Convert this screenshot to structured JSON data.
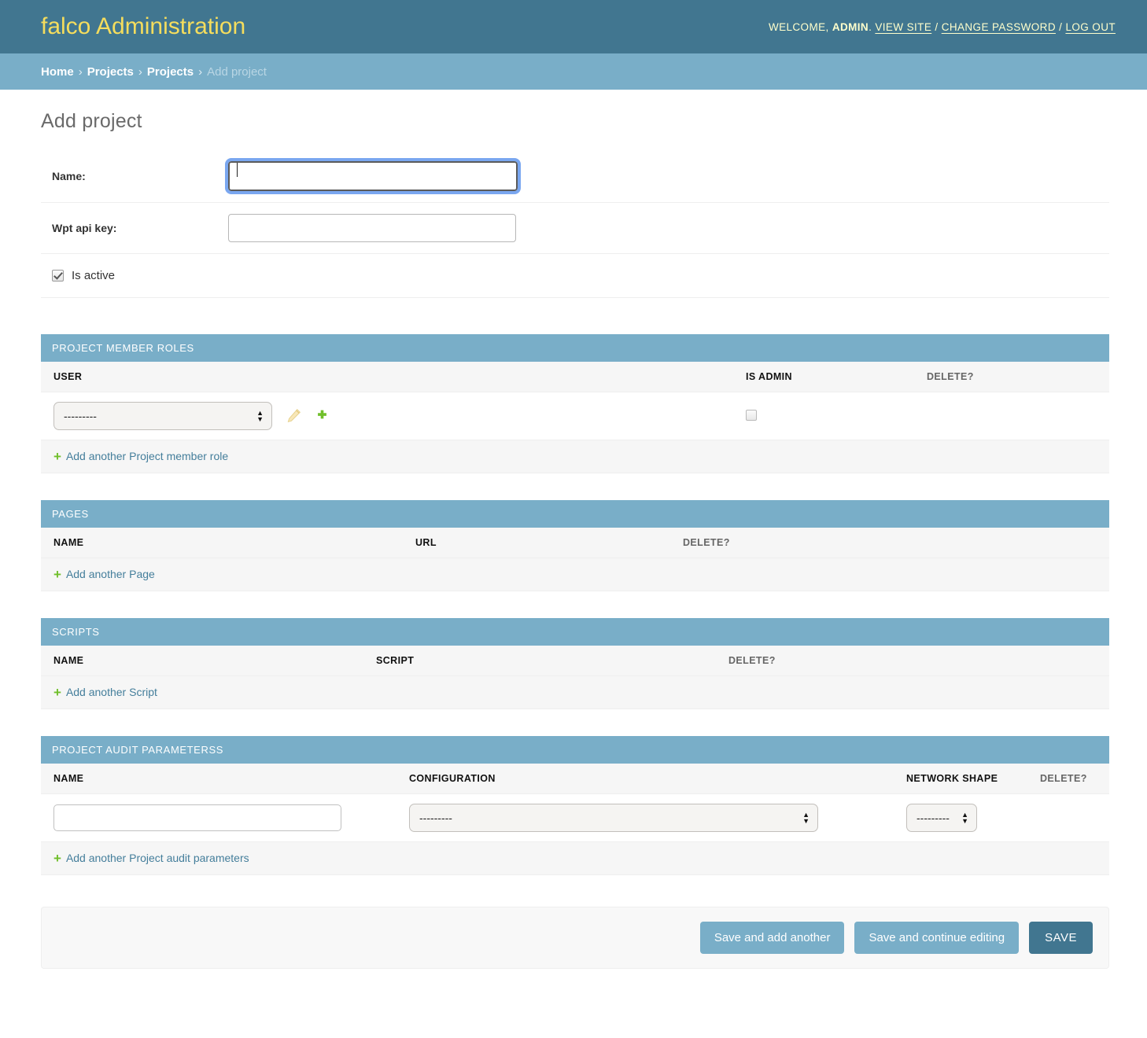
{
  "header": {
    "branding": "falco Administration",
    "welcome_prefix": "WELCOME,",
    "username": "ADMIN",
    "dot": ".",
    "view_site": "VIEW SITE",
    "sep1": "/",
    "change_password": "CHANGE PASSWORD",
    "sep2": "/",
    "log_out": "LOG OUT",
    "brand_color": "#f5dd5d",
    "bg_color": "#417690"
  },
  "breadcrumbs": {
    "items": [
      {
        "label": "Home",
        "current": false
      },
      {
        "label": "Projects",
        "current": false
      },
      {
        "label": "Projects",
        "current": false
      },
      {
        "label": "Add project",
        "current": true
      }
    ],
    "separator": "›",
    "bg_color": "#79aec8"
  },
  "page": {
    "title": "Add project"
  },
  "form": {
    "name": {
      "label": "Name:",
      "value": "",
      "focused": true
    },
    "wpt_api_key": {
      "label": "Wpt api key:",
      "value": ""
    },
    "is_active": {
      "label": "Is active",
      "checked": true
    }
  },
  "inlines": [
    {
      "id": "project-member-roles",
      "heading": "PROJECT MEMBER ROLES",
      "columns": [
        {
          "label": "USER",
          "muted": false
        },
        {
          "label": "IS ADMIN",
          "muted": false
        },
        {
          "label": "DELETE?",
          "muted": true
        }
      ],
      "row": {
        "user_select_value": "---------",
        "is_admin_checked": false,
        "edit_icon": "pencil-icon",
        "add_icon": "plus-icon"
      },
      "add_another": "Add another Project member role"
    },
    {
      "id": "pages",
      "heading": "PAGES",
      "columns": [
        {
          "label": "NAME",
          "muted": false
        },
        {
          "label": "URL",
          "muted": false
        },
        {
          "label": "DELETE?",
          "muted": true
        }
      ],
      "add_another": "Add another Page"
    },
    {
      "id": "scripts",
      "heading": "SCRIPTS",
      "columns": [
        {
          "label": "NAME",
          "muted": false
        },
        {
          "label": "SCRIPT",
          "muted": false
        },
        {
          "label": "DELETE?",
          "muted": true
        }
      ],
      "add_another": "Add another Script"
    },
    {
      "id": "project-audit-parameterss",
      "heading": "PROJECT AUDIT PARAMETERSS",
      "columns": [
        {
          "label": "NAME",
          "muted": false
        },
        {
          "label": "CONFIGURATION",
          "muted": false
        },
        {
          "label": "NETWORK SHAPE",
          "muted": false
        },
        {
          "label": "DELETE?",
          "muted": true
        }
      ],
      "row": {
        "name_value": "",
        "configuration_value": "---------",
        "network_shape_value": "---------"
      },
      "add_another": "Add another Project audit parameters"
    }
  ],
  "submit": {
    "save_and_add_another": "Save and add another",
    "save_and_continue": "Save and continue editing",
    "save": "SAVE"
  },
  "colors": {
    "accent": "#79aec8",
    "dark_accent": "#417690",
    "link": "#447e9b",
    "green": "#70bf2b",
    "focus_ring": "#7aa7f0"
  }
}
